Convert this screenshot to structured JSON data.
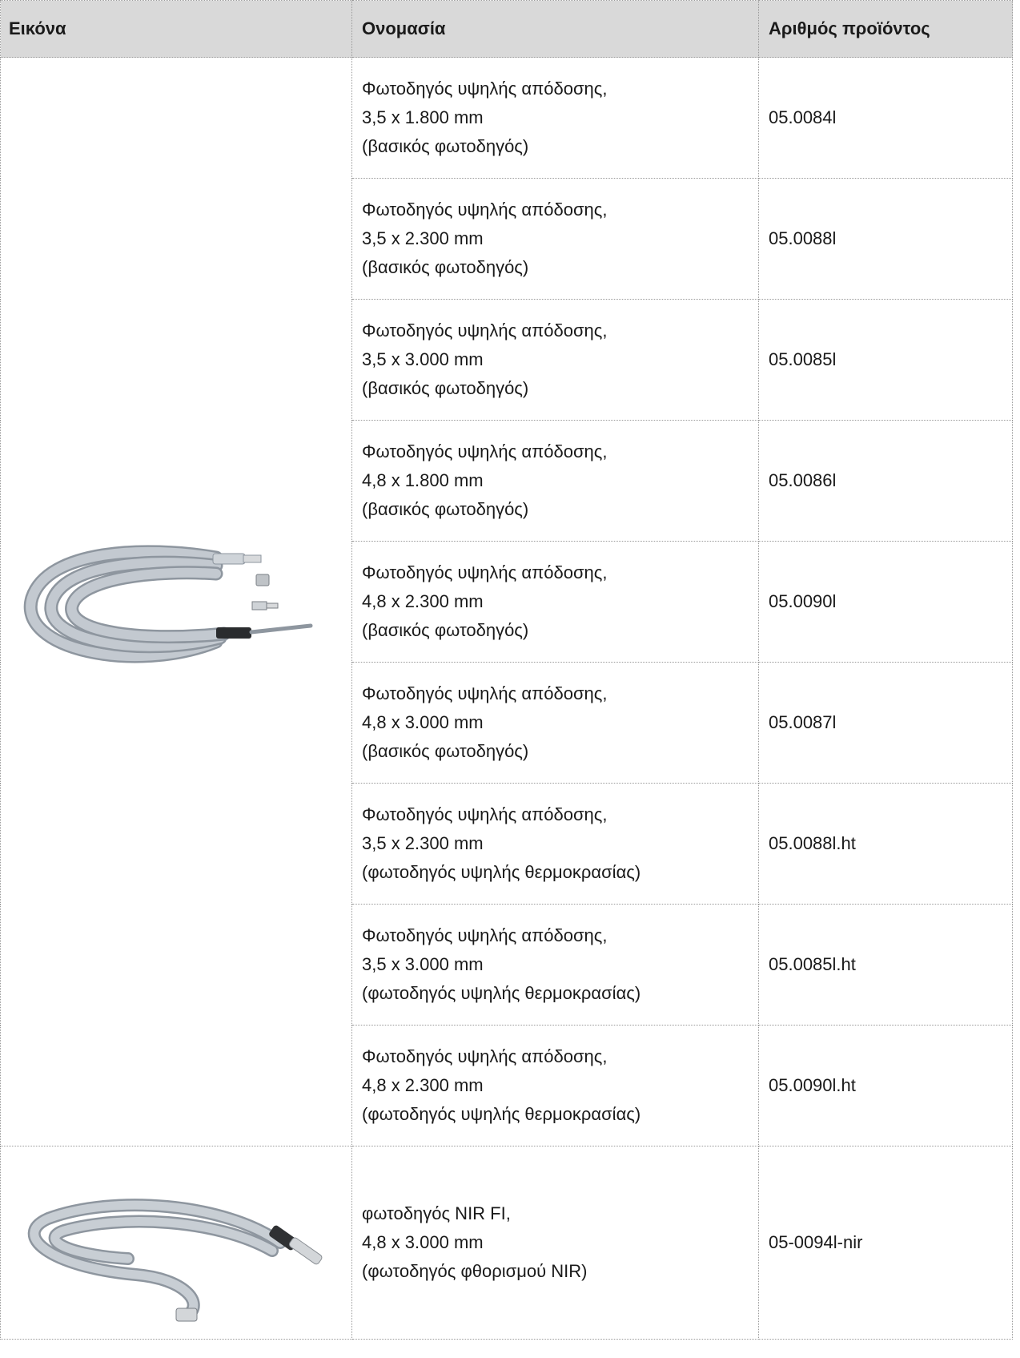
{
  "table": {
    "headers": [
      "Εικόνα",
      "Ονομασία",
      "Αριθμός προϊόντος"
    ],
    "rows": [
      {
        "name": [
          "Φωτοδηγός υψηλής απόδοσης,",
          "3,5 x 1.800 mm",
          "(βασικός φωτοδηγός)"
        ],
        "code": "05.0084l"
      },
      {
        "name": [
          "Φωτοδηγός υψηλής απόδοσης,",
          "3,5 x 2.300 mm",
          "(βασικός φωτοδηγός)"
        ],
        "code": "05.0088l"
      },
      {
        "name": [
          "Φωτοδηγός υψηλής απόδοσης,",
          "3,5 x 3.000 mm",
          "(βασικός φωτοδηγός)"
        ],
        "code": "05.0085l"
      },
      {
        "name": [
          "Φωτοδηγός υψηλής απόδοσης,",
          "4,8 x 1.800 mm",
          "(βασικός φωτοδηγός)"
        ],
        "code": "05.0086l"
      },
      {
        "name": [
          "Φωτοδηγός υψηλής απόδοσης,",
          "4,8 x 2.300 mm",
          "(βασικός φωτοδηγός)"
        ],
        "code": "05.0090l"
      },
      {
        "name": [
          "Φωτοδηγός υψηλής απόδοσης,",
          "4,8 x 3.000 mm",
          "(βασικός φωτοδηγός)"
        ],
        "code": "05.0087l"
      },
      {
        "name": [
          "Φωτοδηγός υψηλής απόδοσης,",
          "3,5 x 2.300 mm",
          "(φωτοδηγός υψηλής θερμοκρασίας)"
        ],
        "code": "05.0088l.ht"
      },
      {
        "name": [
          "Φωτοδηγός υψηλής απόδοσης,",
          "3,5 x 3.000 mm",
          "(φωτοδηγός υψηλής θερμοκρασίας)"
        ],
        "code": "05.0085l.ht"
      },
      {
        "name": [
          "Φωτοδηγός υψηλής απόδοσης,",
          "4,8 x 2.300 mm",
          "(φωτοδηγός υψηλής θερμοκρασίας)"
        ],
        "code": "05.0090l.ht"
      },
      {
        "name": [
          "φωτοδηγός NIR FI,",
          "4,8 x 3.000 mm",
          "(φωτοδηγός φθορισμού NIR)"
        ],
        "code": "05-0094l-nir"
      }
    ]
  },
  "colors": {
    "header_bg": "#d9d9d9",
    "cable": "#b9c0c8",
    "cable_dark": "#8e969f"
  }
}
